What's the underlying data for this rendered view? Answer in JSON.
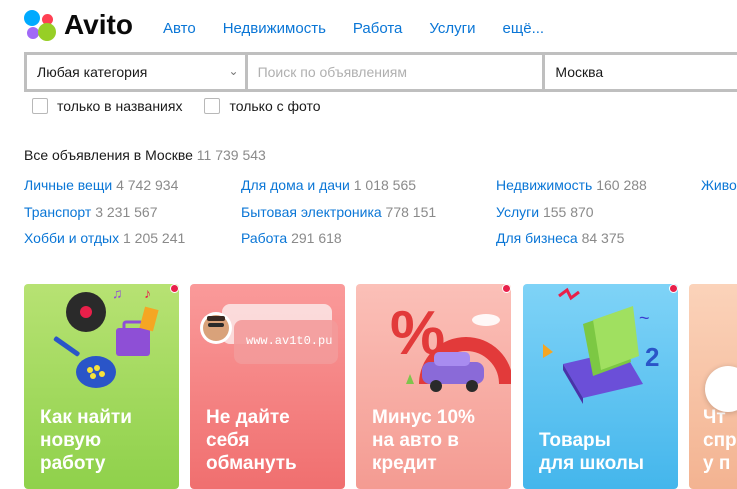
{
  "header": {
    "logo_text": "Avito",
    "nav": [
      "Авто",
      "Недвижимость",
      "Работа",
      "Услуги",
      "ещё..."
    ]
  },
  "search": {
    "category": "Любая категория",
    "placeholder": "Поиск по объявлениям",
    "city": "Москва"
  },
  "filters": {
    "titles_only": "только в названиях",
    "with_photo": "только с фото"
  },
  "listing": {
    "all_label": "Все объявления в Москве",
    "all_count": "11 739 543",
    "categories": [
      {
        "name": "Личные вещи",
        "count": "4 742 934"
      },
      {
        "name": "Транспорт",
        "count": "3 231 567"
      },
      {
        "name": "Хобби и отдых",
        "count": "1 205 241"
      },
      {
        "name": "Для дома и дачи",
        "count": "1 018 565"
      },
      {
        "name": "Бытовая электроника",
        "count": "778 151"
      },
      {
        "name": "Работа",
        "count": "291 618"
      },
      {
        "name": "Недвижимость",
        "count": "160 288"
      },
      {
        "name": "Услуги",
        "count": "155 870"
      },
      {
        "name": "Для бизнеса",
        "count": "84 375"
      },
      {
        "name": "Живо",
        "count": ""
      }
    ]
  },
  "cards": [
    {
      "title": "Как найти\nновую\nработу",
      "color": "#9ed85a"
    },
    {
      "title": "Не дайте\nсебя\nобмануть",
      "color": "#f47f7f",
      "banner_text": "www.av1t0.pu"
    },
    {
      "title": "Минус 10%\nна авто в\nкредит",
      "color": "#f5a6a0"
    },
    {
      "title": "Товары\nдля школы",
      "color": "#52bff0"
    },
    {
      "title": "Чт\nспр\nу п",
      "color": "#f7c2a3"
    }
  ],
  "colors": {
    "link": "#0a76d6",
    "logo_dots": [
      "#00aaff",
      "#97cf26",
      "#ff4053",
      "#a169f7"
    ],
    "badge": "#e8204a"
  }
}
